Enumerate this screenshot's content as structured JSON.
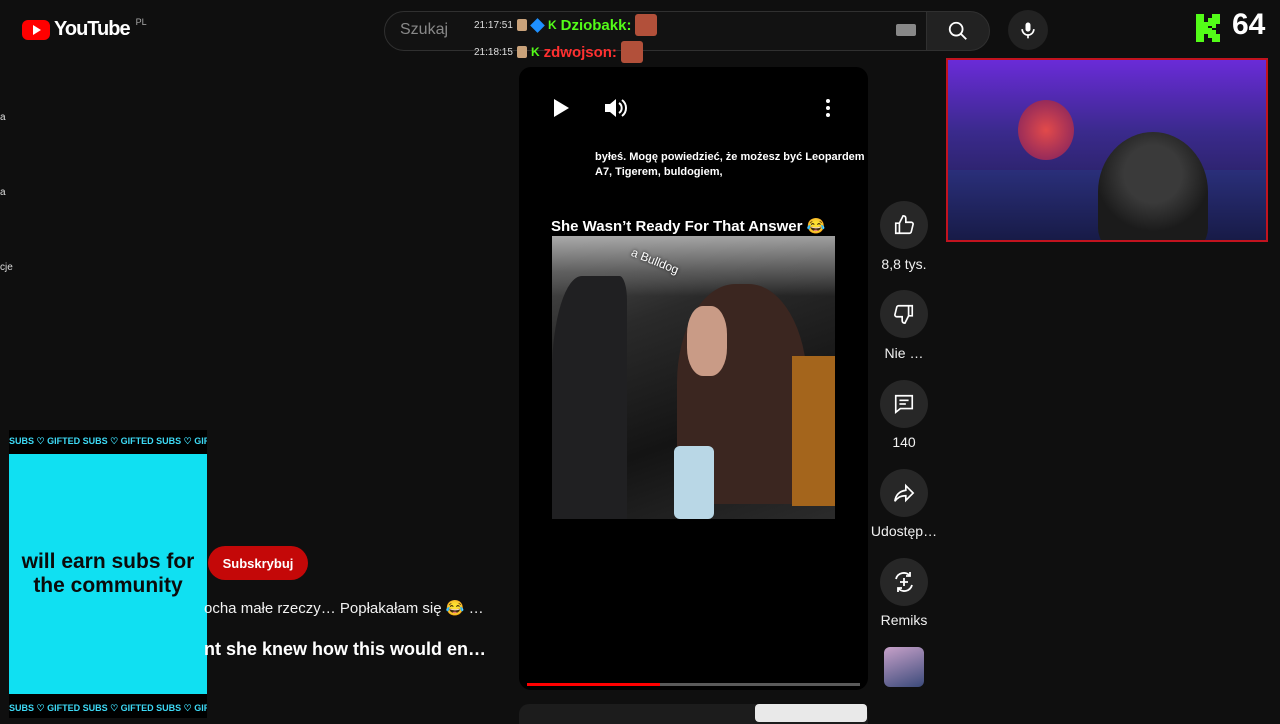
{
  "header": {
    "logo_text": "YouTube",
    "region": "PL",
    "search_placeholder": "Szukaj"
  },
  "chat": [
    {
      "time": "21:17:51",
      "user": "Dziobakk:",
      "color": "green"
    },
    {
      "time": "21:18:15",
      "user": "zdwojson:",
      "color": "red"
    }
  ],
  "kick": {
    "viewers": "64"
  },
  "sidebar_fragments": [
    "a",
    "a",
    "cje"
  ],
  "sub_ad": {
    "marquee": "SUBS ♡ GIFTED SUBS ♡ GIFTED SUBS ♡ GIFTED SUBS ♡ GIFTI",
    "text": "will earn subs for the community"
  },
  "channel": {
    "subscribe_label": "Subskrybuj",
    "description": "ocha małe rzeczy… Popłakałam się 😂 …",
    "next_title": "nt she knew how this would en…"
  },
  "short": {
    "subtitle_text": "byłeś.  Mogę powiedzieć, że możesz być Leopardem A7, Tigerem, buldogiem,",
    "video_title": "She Wasn’t Ready For That Answer 😂",
    "overlay_caption": "a Bulldog",
    "progress": 0.4
  },
  "actions": {
    "like_count": "8,8 tys.",
    "dislike_label": "Nie …",
    "comment_count": "140",
    "share_label": "Udostęp…",
    "remix_label": "Remiks"
  }
}
